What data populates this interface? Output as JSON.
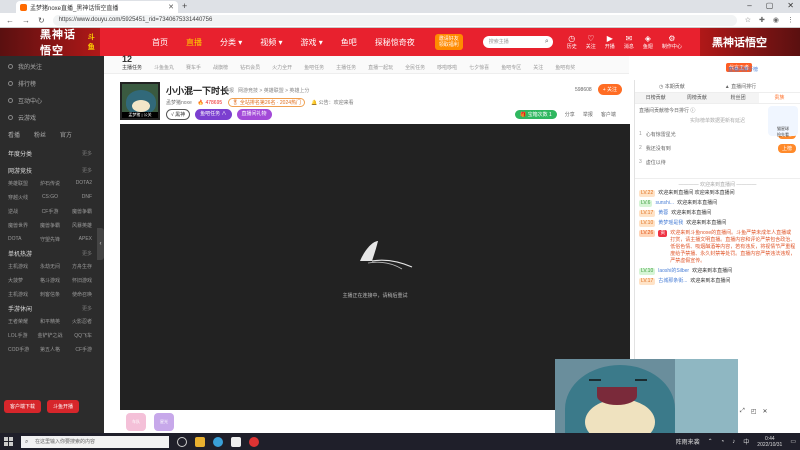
{
  "browser": {
    "tab_title": "孟梦猪noxe直播_黑神话悟空直播",
    "url": "https://www.douyu.com/5925451_rid=7340675331440756",
    "new_tab": "+",
    "minimize": "–",
    "maximize": "▢",
    "close": "✕"
  },
  "header": {
    "logo": "黑神话悟空",
    "logo_sub": "斗鱼",
    "nav": [
      "首页",
      "直播",
      "分类 ▾",
      "视频 ▾",
      "游戏 ▾",
      "鱼吧",
      "探秘惊奇夜"
    ],
    "promo": "邀请好友\n领取福利",
    "search_placeholder": "搜索主播",
    "icons": [
      {
        "label": "历史",
        "glyph": "◷"
      },
      {
        "label": "关注",
        "glyph": "♡"
      },
      {
        "label": "开播",
        "glyph": "▶"
      },
      {
        "label": "消息",
        "glyph": "✉"
      },
      {
        "label": "鱼翅",
        "glyph": "◈"
      },
      {
        "label": "制作中心",
        "glyph": "⚙"
      }
    ],
    "logo_right": "黑神话悟空"
  },
  "sidebar": {
    "top_items": [
      "我的关注",
      "排行榜",
      "互动中心",
      "云游戏"
    ],
    "misc_row": [
      "看播",
      "粉丝",
      "官方"
    ],
    "sections": [
      {
        "title": "年度分类",
        "more": "更多"
      },
      {
        "title": "网游竞技",
        "more": "更多",
        "items": [
          "英雄联盟",
          "炉石传说",
          "DOTA2",
          "穿越火线",
          "CS:GO",
          "DNF",
          "炉石传说",
          "CS:GO",
          "逆战",
          "CF手游",
          "魔兽争霸",
          "魔兽世界",
          "风暴英雄",
          "守望先锋",
          "DOTA",
          "魔兽怀旧",
          "APEX",
          "APEX"
        ]
      },
      {
        "title": "单机热游",
        "more": "更多",
        "items": [
          "主机游戏",
          "永劫无间",
          "方舟生存",
          "大菠萝",
          "格斗游戏",
          "怀旧游戏",
          "主机游戏",
          "刺客信条",
          "使命召唤"
        ]
      },
      {
        "title": "手游休闲",
        "more": "更多",
        "items": [
          "王者荣耀",
          "和平精英",
          "火影忍者",
          "LOL手游",
          "金铲铲之战",
          "QQ飞车",
          "COD手游",
          "第五人格",
          "CF手游"
        ]
      }
    ],
    "bottom_buttons": [
      "客户端下载",
      "斗鱼开播"
    ],
    "collapse_glyph": "‹"
  },
  "gift_strip": {
    "first_num": "12",
    "first_label": "主播任务",
    "items": [
      "斗鱼鱼丸",
      "赛车手",
      "战旗榜",
      "钻石会员",
      "火力全开",
      "鱼吧任务",
      "主播任务",
      "直播一起玩",
      "全民任务",
      "哆啦哆啦",
      "七夕惊喜",
      "鱼吧专区",
      "关注",
      "鱼吧有奖",
      "鱼吧会员",
      "礼物"
    ],
    "badge": "代言王者",
    "sub": "直播间排行榜"
  },
  "room": {
    "avatar_tag": "孟梦猪 | 公关",
    "title": "小小混一下时长",
    "meta": [
      "举报",
      "网游竞技 > 英雄联盟 > 英雄上分"
    ],
    "host_name": "孟梦猪noxe",
    "hot": "🔥 478695",
    "rank": "🎖 全站排名第26名 · 2024热门",
    "announce": "🔔 公告：欢迎来看",
    "badges": [
      "√ 黑神",
      "鱼吧任务 ∧",
      "直播间礼物"
    ],
    "follow_count": "598608",
    "follow_label": "+ 关注",
    "treasure": "🎁 宝箱次数 1",
    "actions": [
      "分享",
      "举报",
      "客户端"
    ]
  },
  "player": {
    "message": "主播正在连接中，请稍后重试"
  },
  "player_bar": [
    "车队",
    "星光",
    "粉丝团",
    "皮肤"
  ],
  "chat": {
    "top": [
      "◷ 本期贡献",
      "▲ 直播间排行"
    ],
    "tabs": [
      "日榜贡献",
      "周榜贡献",
      "粉丝团",
      "贵族"
    ],
    "ranks": [
      {
        "num": "1",
        "name": "心有惊雷星光",
        "go": "上榜"
      },
      {
        "num": "2",
        "name": "我还没有到",
        "go": "上榜"
      },
      {
        "num": "3",
        "name": "虚位以待",
        "go": ""
      }
    ],
    "rank_title": "直播间贡献榜今日排行 ⓘ",
    "rank_sub": "实际榜单数据更新有延迟",
    "cat_badge": "猫星球\n抢先看",
    "separator": "———— 欢迎来到直播间 ————",
    "messages": [
      {
        "lvl": "LV.22",
        "style": "",
        "rb": "",
        "user": "",
        "text": "欢迎来到直播间 欢迎来到本直播间"
      },
      {
        "lvl": "LV.6",
        "style": "g",
        "rb": "",
        "user": "sunshi...",
        "text": "欢迎来到本直播间"
      },
      {
        "lvl": "LV.17",
        "style": "",
        "rb": "",
        "user": "黄蓉",
        "text": "欢迎来到本直播间"
      },
      {
        "lvl": "LV.10",
        "style": "",
        "rb": "",
        "user": "黄梦瑶是我",
        "text": "欢迎来到本直播间"
      },
      {
        "lvl": "LV.26",
        "style": "o",
        "rb": "贵",
        "user": "",
        "text": "欢迎来到斗鱼noxe的直播间。斗鱼严禁未成年人直播或打赏，请主播文明直播。直播内容和评论严禁包含政治、低俗色情、吸烟酗酒等内容，若有违反，将视情节严重程度给予禁播、永久封禁等处罚。直播内容严禁违法违规，严禁虚假宣传。"
      },
      {
        "lvl": "LV.10",
        "style": "g",
        "rb": "",
        "user": "laoshi的Silber",
        "text": "欢迎来到本直播间"
      },
      {
        "lvl": "LV.17",
        "style": "",
        "rb": "",
        "user": "古城那条街...",
        "text": "欢迎来到本直播间"
      }
    ]
  },
  "pip": {
    "controls": [
      "⤢",
      "◰",
      "✕"
    ]
  },
  "taskbar": {
    "search_placeholder": "在这里输入你要搜索的内容",
    "weather": "阵雨来袭",
    "time": "0:44",
    "date": "2022/10/31"
  }
}
